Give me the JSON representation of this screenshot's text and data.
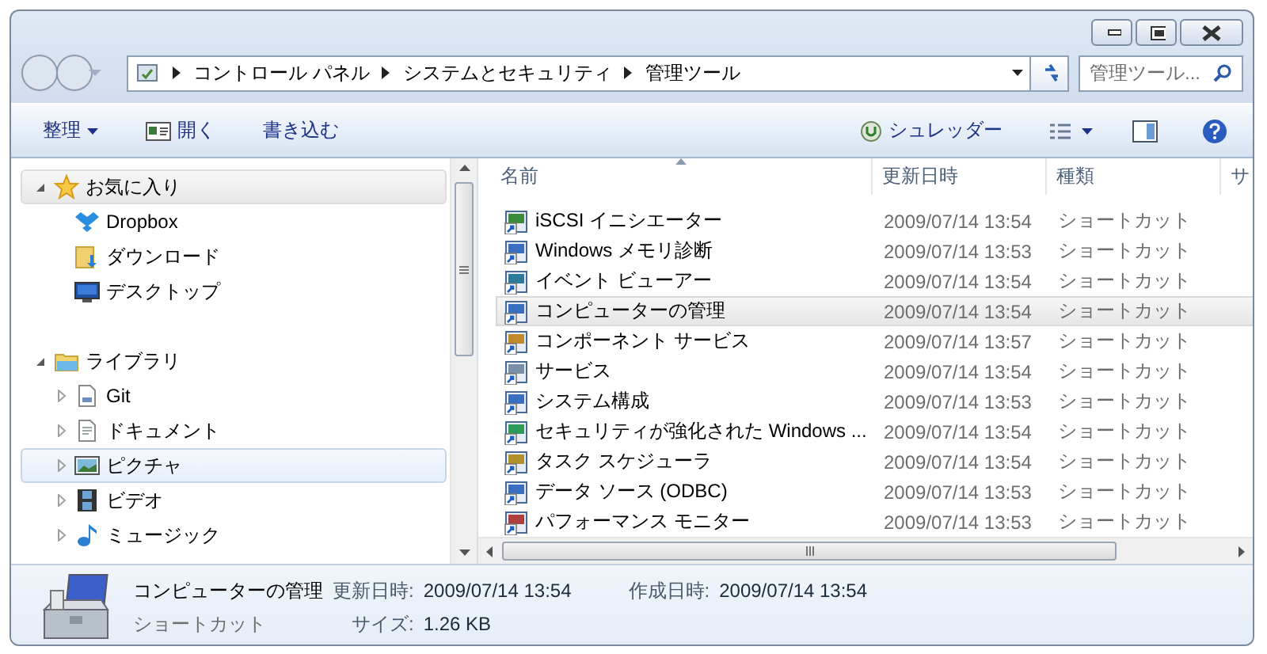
{
  "address_bar": {
    "path": [
      "コントロール パネル",
      "システムとセキュリティ",
      "管理ツール"
    ]
  },
  "search": {
    "placeholder": "管理ツール..."
  },
  "toolbar": {
    "left": [
      {
        "label": "整理",
        "kind": "menu"
      },
      {
        "label": "開く",
        "kind": "open"
      },
      {
        "label": "書き込む",
        "kind": "plain"
      }
    ],
    "right": [
      {
        "label": "シュレッダー"
      }
    ]
  },
  "nav": [
    {
      "label": "お気に入り",
      "expanded": true,
      "selected": false,
      "highlighted": true,
      "children": [
        {
          "label": "Dropbox",
          "selected": false,
          "highlighted": false
        },
        {
          "label": "ダウンロード",
          "selected": false,
          "highlighted": false
        },
        {
          "label": "デスクトップ",
          "selected": false,
          "highlighted": false
        }
      ]
    },
    {
      "label": "ライブラリ",
      "expanded": true,
      "selected": false,
      "highlighted": false,
      "children": [
        {
          "label": "Git",
          "expanded": false,
          "selected": false,
          "highlighted": false
        },
        {
          "label": "ドキュメント",
          "expanded": false,
          "selected": false,
          "highlighted": false
        },
        {
          "label": "ピクチャ",
          "expanded": false,
          "selected": true,
          "highlighted": false
        },
        {
          "label": "ビデオ",
          "expanded": false,
          "selected": false,
          "highlighted": false
        },
        {
          "label": "ミュージック",
          "expanded": false,
          "selected": false,
          "highlighted": false
        }
      ]
    }
  ],
  "table": {
    "columns": [
      {
        "label": "名前",
        "sorted": true
      },
      {
        "label": "更新日時",
        "sorted": false
      },
      {
        "label": "種類",
        "sorted": false
      },
      {
        "label": "サ",
        "sorted": false
      }
    ],
    "rows": [
      {
        "name": "iSCSI イニシエーター",
        "modified": "2009/07/14 13:54",
        "type": "ショートカット",
        "selected": false
      },
      {
        "name": "Windows メモリ診断",
        "modified": "2009/07/14 13:53",
        "type": "ショートカット",
        "selected": false
      },
      {
        "name": "イベント ビューアー",
        "modified": "2009/07/14 13:54",
        "type": "ショートカット",
        "selected": false
      },
      {
        "name": "コンピューターの管理",
        "modified": "2009/07/14 13:54",
        "type": "ショートカット",
        "selected": true
      },
      {
        "name": "コンポーネント サービス",
        "modified": "2009/07/14 13:57",
        "type": "ショートカット",
        "selected": false
      },
      {
        "name": "サービス",
        "modified": "2009/07/14 13:54",
        "type": "ショートカット",
        "selected": false
      },
      {
        "name": "システム構成",
        "modified": "2009/07/14 13:53",
        "type": "ショートカット",
        "selected": false
      },
      {
        "name": "セキュリティが強化された Windows ...",
        "modified": "2009/07/14 13:54",
        "type": "ショートカット",
        "selected": false
      },
      {
        "name": "タスク スケジューラ",
        "modified": "2009/07/14 13:54",
        "type": "ショートカット",
        "selected": false
      },
      {
        "name": "データ ソース (ODBC)",
        "modified": "2009/07/14 13:53",
        "type": "ショートカット",
        "selected": false
      },
      {
        "name": "パフォーマンス モニター",
        "modified": "2009/07/14 13:53",
        "type": "ショートカット",
        "selected": false
      }
    ]
  },
  "details": {
    "name": "コンピューターの管理",
    "type": "ショートカット",
    "modified_label": "更新日時:",
    "modified": "2009/07/14 13:54",
    "created_label": "作成日時:",
    "created": "2009/07/14 13:54",
    "size_label": "サイズ:",
    "size": "1.26 KB"
  }
}
